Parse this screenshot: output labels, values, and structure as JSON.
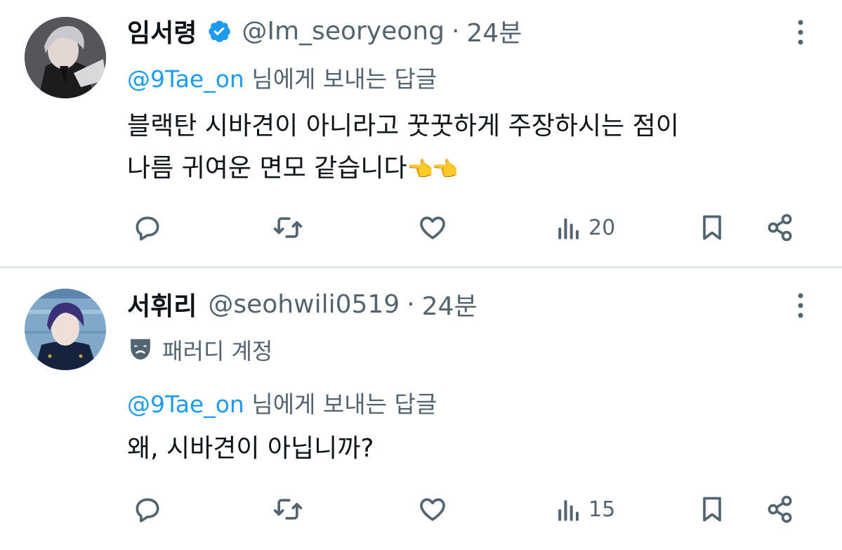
{
  "replies": [
    {
      "display_name": "임서령",
      "verified": true,
      "handle": "@Im_seoryeong",
      "separator": "·",
      "time": "24분",
      "replying_to_handle": "@9Tae_on",
      "replying_to_suffix": "님에게 보내는 답글",
      "text_line1": "블랙탄 시바견이 아니라고 꿋꿋하게 주장하시는 점이",
      "text_line2": "나름 귀여운 면모 같습니다",
      "emoji": "👈👈",
      "views": "20",
      "avatar_icon": "avatar-dark-haired-man"
    },
    {
      "display_name": "서휘리",
      "verified": false,
      "handle": "@seohwili0519",
      "separator": "·",
      "time": "24분",
      "parody_label": "패러디 계정",
      "parody_icon": "theater-mask-icon",
      "replying_to_handle": "@9Tae_on",
      "replying_to_suffix": "님에게 보내는 답글",
      "text_line1": "왜, 시바견이 아닙니까?",
      "views": "15",
      "avatar_icon": "avatar-blue-haired-man"
    }
  ],
  "colors": {
    "text": "#0f1419",
    "secondary": "#536471",
    "accent": "#1d9bf0",
    "divider": "#e6e9ec"
  }
}
